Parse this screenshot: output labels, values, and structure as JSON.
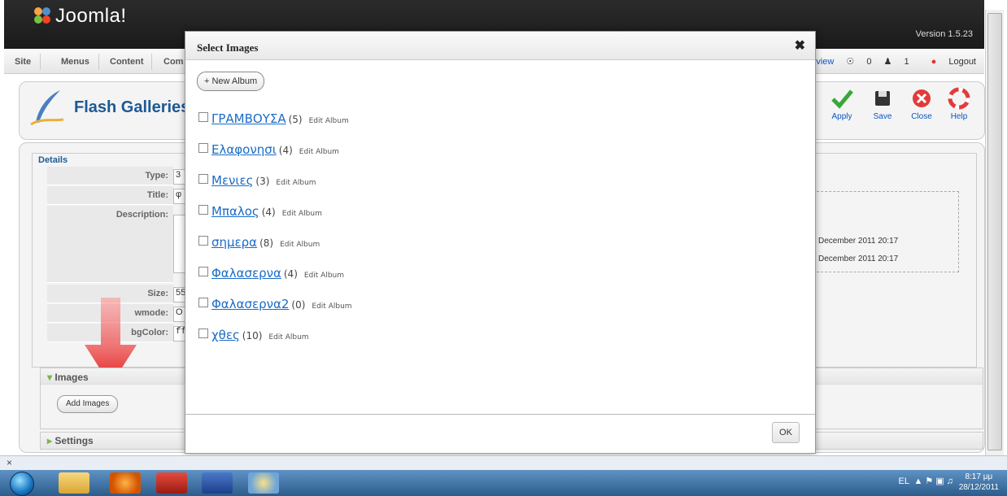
{
  "joomla": {
    "logo": "Joomla!",
    "version": "Version 1.5.23",
    "menu": [
      "Site",
      "Menus",
      "Content",
      "Com"
    ],
    "status": {
      "preview": "Preview",
      "count1": "0",
      "count2": "1",
      "logout": "Logout"
    },
    "page_title": "Flash Galleries",
    "toolbar": {
      "apply": "Apply",
      "save": "Save",
      "close": "Close",
      "help": "Help"
    },
    "details": {
      "legend": "Details",
      "fields": [
        {
          "label": "Type:",
          "value": "3"
        },
        {
          "label": "Title:",
          "value": "φ"
        },
        {
          "label": "Description:",
          "value": ""
        },
        {
          "label": "Size:",
          "value": "55"
        },
        {
          "label": "wmode:",
          "value": "O"
        },
        {
          "label": "bgColor:",
          "value": "ff"
        }
      ],
      "dates": [
        "December 2011 20:17",
        "December 2011 20:17"
      ]
    },
    "images_panel": {
      "title": "Images",
      "add_button": "Add Images"
    },
    "settings_panel": {
      "title": "Settings"
    }
  },
  "modal": {
    "title": "Select Images",
    "close": "✖",
    "new_album": "+ New Album",
    "edit_label": "Edit Album",
    "albums": [
      {
        "name": "ΓΡΑΜΒΟΥΣΑ",
        "count": "(5)"
      },
      {
        "name": "Ελαφονησι",
        "count": "(4)"
      },
      {
        "name": "Μενιες",
        "count": "(3)"
      },
      {
        "name": "Μπαλος",
        "count": "(4)"
      },
      {
        "name": "σημερα",
        "count": "(8)"
      },
      {
        "name": "Φαλασερνα",
        "count": "(4)"
      },
      {
        "name": "Φαλασερνα2",
        "count": "(0)"
      },
      {
        "name": "χθες",
        "count": "(10)"
      }
    ],
    "ok": "OK"
  },
  "findbar": {
    "close": "×"
  },
  "taskbar": {
    "lang": "EL",
    "time": "8:17 μμ",
    "date": "28/12/2011"
  },
  "colors": {
    "accent": "#8fc045",
    "link": "#1a6cc8",
    "title": "#1c5995",
    "arrow": "#e02020"
  }
}
